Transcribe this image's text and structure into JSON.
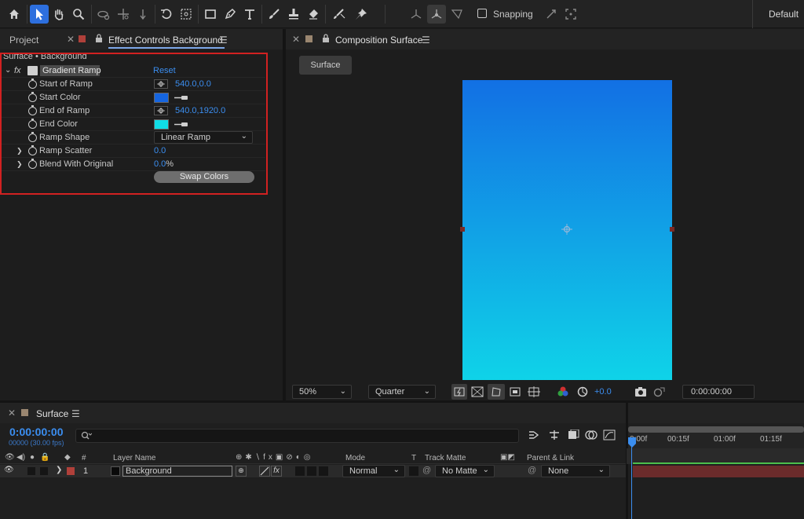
{
  "toolbar": {
    "snapping_label": "Snapping",
    "workspace_label": "Default",
    "active_tool": "selection"
  },
  "left_panel": {
    "tab_project": "Project",
    "tab_effect_controls": "Effect Controls Background",
    "breadcrumb": "Surface • Background",
    "effect": {
      "fx_label": "fx",
      "name": "Gradient Ramp",
      "reset_label": "Reset",
      "properties": {
        "start_of_ramp": {
          "label": "Start of Ramp",
          "value": "540.0,0.0"
        },
        "start_color": {
          "label": "Start Color",
          "color": "#1565e0"
        },
        "end_of_ramp": {
          "label": "End of Ramp",
          "value": "540.0,1920.0"
        },
        "end_color": {
          "label": "End Color",
          "color": "#10dde6"
        },
        "ramp_shape": {
          "label": "Ramp Shape",
          "value": "Linear Ramp"
        },
        "ramp_scatter": {
          "label": "Ramp Scatter",
          "value": "0.0"
        },
        "blend_with_original": {
          "label": "Blend With Original",
          "value": "0.0",
          "unit": "%"
        }
      },
      "swap_colors_label": "Swap Colors"
    }
  },
  "comp_panel": {
    "tab_label": "Composition Surface",
    "surface_button": "Surface",
    "zoom": "50%",
    "resolution": "Quarter",
    "exposure": "+0.0",
    "timecode": "0:00:00:00"
  },
  "timeline": {
    "tab_label": "Surface",
    "timecode": "0:00:00:00",
    "fps_label": "00000 (30.00 fps)",
    "ruler_ticks": [
      "0:00f",
      "00:15f",
      "01:00f",
      "01:15f"
    ],
    "columns": {
      "number": "#",
      "layer_name": "Layer Name",
      "mode": "Mode",
      "t": "T",
      "track_matte": "Track Matte",
      "parent_link": "Parent & Link"
    },
    "layer": {
      "number": "1",
      "name": "Background",
      "mode": "Normal",
      "track_matte": "No Matte",
      "parent": "None"
    }
  },
  "colors": {
    "accent": "#2d6fde",
    "value_blue": "#3b8ef0",
    "highlight_red": "#d12121",
    "layer_bar": "#6b2b2b"
  }
}
